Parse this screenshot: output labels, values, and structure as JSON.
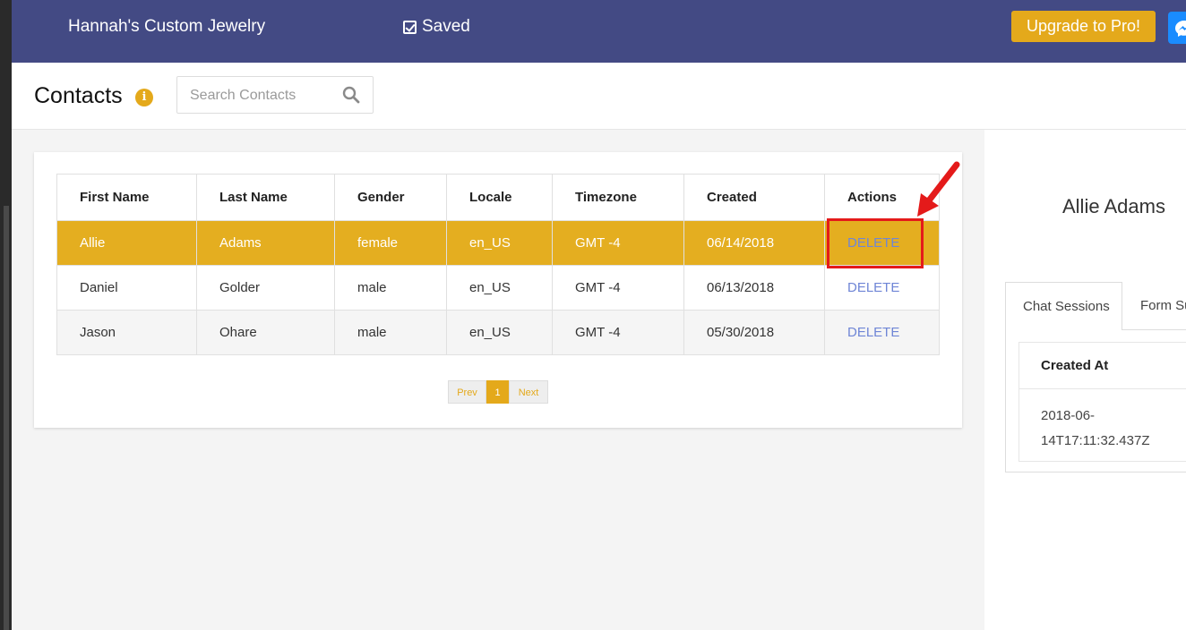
{
  "topbar": {
    "brand": "Hannah's Custom Jewelry",
    "saved_label": "Saved",
    "upgrade_label": "Upgrade to Pro!"
  },
  "header": {
    "title": "Contacts",
    "search_placeholder": "Search Contacts"
  },
  "table": {
    "columns": [
      "First Name",
      "Last Name",
      "Gender",
      "Locale",
      "Timezone",
      "Created",
      "Actions"
    ],
    "rows": [
      [
        "Allie",
        "Adams",
        "female",
        "en_US",
        "GMT -4",
        "06/14/2018",
        "DELETE"
      ],
      [
        "Daniel",
        "Golder",
        "male",
        "en_US",
        "GMT -4",
        "06/13/2018",
        "DELETE"
      ],
      [
        "Jason",
        "Ohare",
        "male",
        "en_US",
        "GMT -4",
        "05/30/2018",
        "DELETE"
      ]
    ],
    "selected_row": 0
  },
  "pagination": {
    "prev_label": "Prev",
    "current_page": "1",
    "next_label": "Next"
  },
  "detail": {
    "name": "Allie Adams",
    "tabs": [
      "Chat Sessions",
      "Form Submissions"
    ],
    "sessions_header": "Created At",
    "sessions": [
      "2018-06-14T17:11:32.437Z"
    ]
  },
  "colors": {
    "topbar": "#434a84",
    "accent": "#e4a91b",
    "link": "#6f86d6",
    "annotation": "#e41a1a"
  }
}
